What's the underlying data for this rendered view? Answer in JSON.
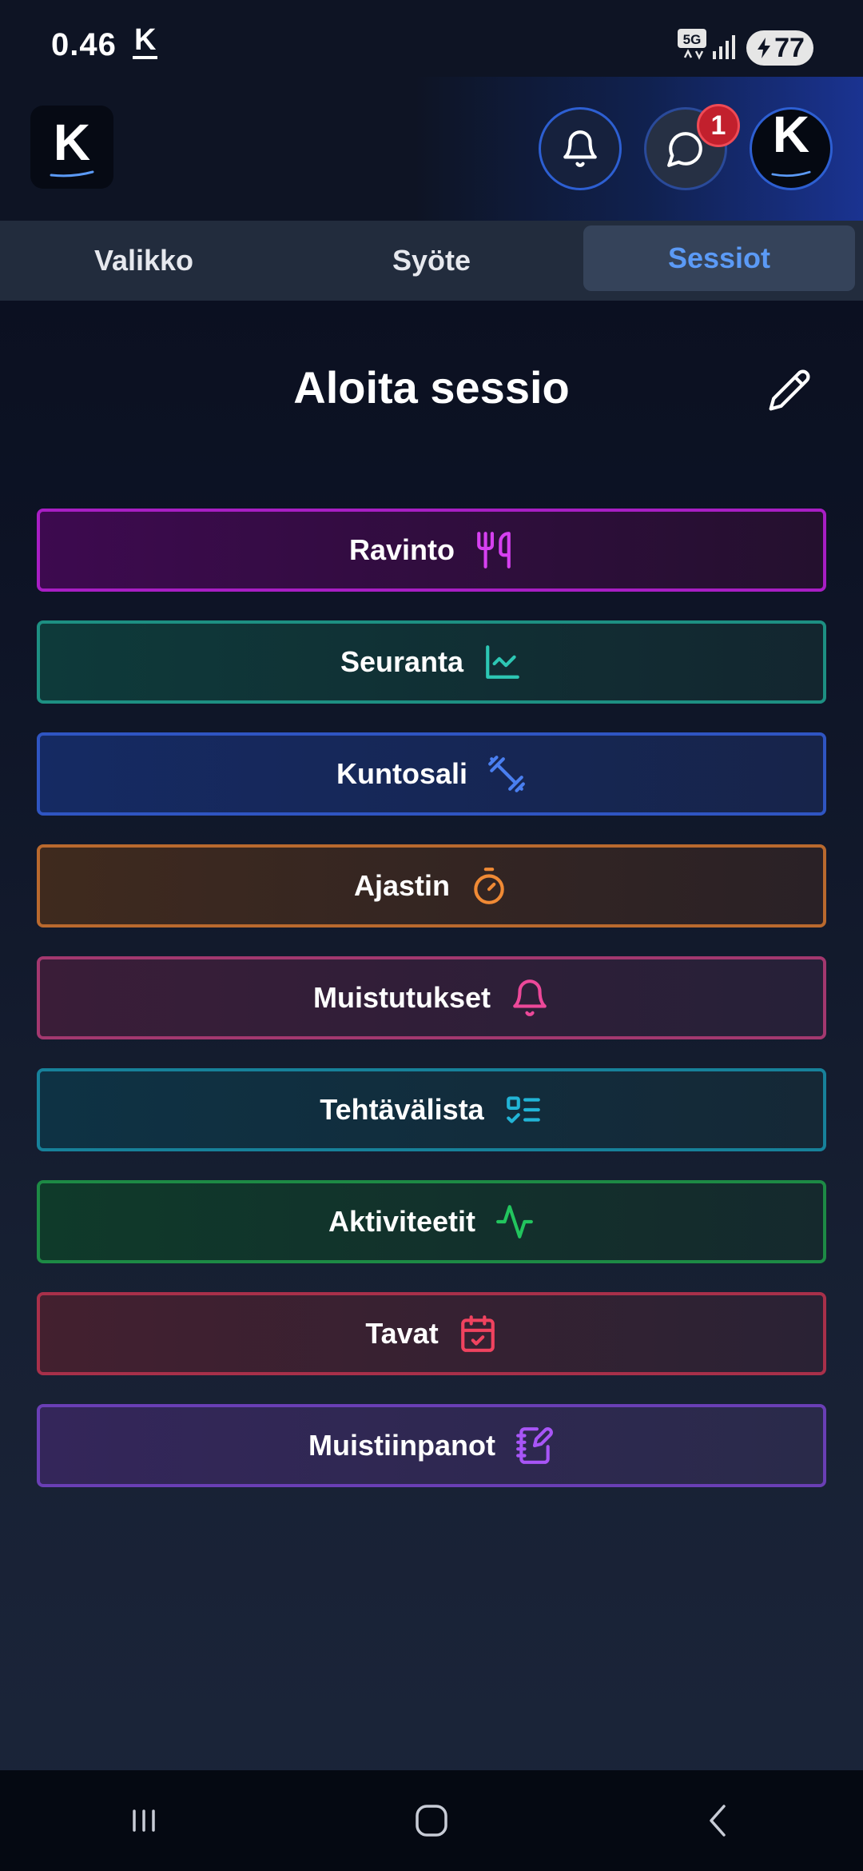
{
  "status_bar": {
    "time": "0.46",
    "app_letter": "K",
    "network": "5G",
    "battery": "77"
  },
  "header": {
    "logo_letter": "K",
    "avatar_letter": "K",
    "chat_badge": "1"
  },
  "tabs": [
    {
      "label": "Valikko",
      "active": false
    },
    {
      "label": "Syöte",
      "active": false
    },
    {
      "label": "Sessiot",
      "active": true
    }
  ],
  "page": {
    "title": "Aloita sessio"
  },
  "sessions": [
    {
      "label": "Ravinto",
      "icon": "utensils-icon",
      "color": "#a81ec4"
    },
    {
      "label": "Seuranta",
      "icon": "chart-line-icon",
      "color": "#1d8f82"
    },
    {
      "label": "Kuntosali",
      "icon": "dumbbell-icon",
      "color": "#2f55c2"
    },
    {
      "label": "Ajastin",
      "icon": "stopwatch-icon",
      "color": "#b9692e"
    },
    {
      "label": "Muistutukset",
      "icon": "bell-icon",
      "color": "#a3386f"
    },
    {
      "label": "Tehtävälista",
      "icon": "checklist-icon",
      "color": "#17819a"
    },
    {
      "label": "Aktiviteetit",
      "icon": "activity-icon",
      "color": "#1d8a45"
    },
    {
      "label": "Tavat",
      "icon": "calendar-check-icon",
      "color": "#a8304a"
    },
    {
      "label": "Muistiinpanot",
      "icon": "notebook-pen-icon",
      "color": "#6a3fb5"
    }
  ]
}
